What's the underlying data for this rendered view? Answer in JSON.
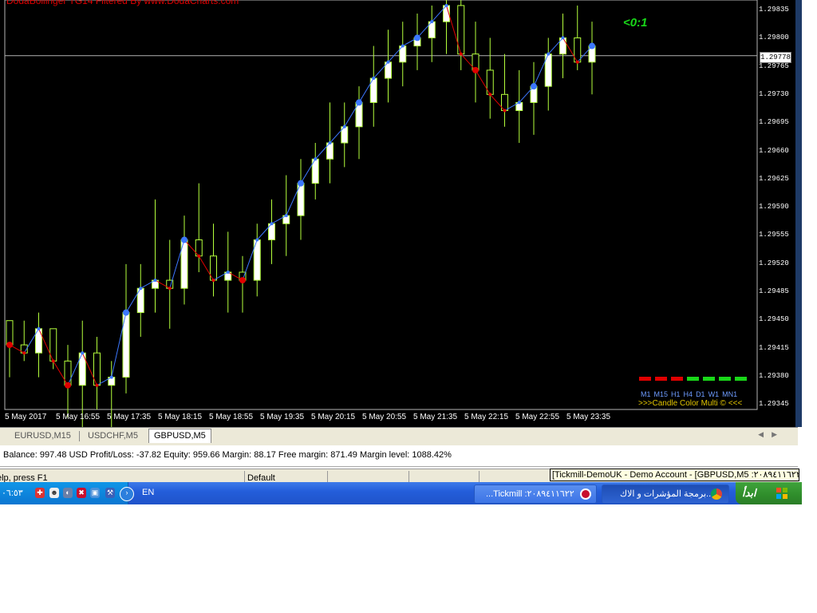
{
  "chart": {
    "title": "DodaBollinger TG14 Filtered By www.DodaCharts.com",
    "current_price": "1.29778",
    "ratio_label": "<0:1",
    "price_labels": [
      "1.29835",
      "1.29800",
      "1.29765",
      "1.29730",
      "1.29695",
      "1.29660",
      "1.29625",
      "1.29590",
      "1.29555",
      "1.29520",
      "1.29485",
      "1.29450",
      "1.29415",
      "1.29380",
      "1.29345"
    ],
    "time_labels": [
      "5 May 2017",
      "5 May 16:55",
      "5 May 17:35",
      "5 May 18:15",
      "5 May 18:55",
      "5 May 19:35",
      "5 May 20:15",
      "5 May 20:55",
      "5 May 21:35",
      "5 May 22:15",
      "5 May 22:55",
      "5 May 23:35"
    ],
    "timeframes": [
      "M1",
      "M15",
      "H1",
      "H4",
      "D1",
      "W1",
      "MN1"
    ],
    "indicator_name": ">>>Candle Color Multi  © <<<",
    "colors": {
      "up": "#b4ff3c",
      "bull_body": "#ffffff",
      "bear_body": "#000000",
      "red": "#e00000",
      "blue": "#3c78ff",
      "green": "#19d719",
      "grid": "#b4b4b4"
    },
    "timeframe_status": [
      "red",
      "red",
      "red",
      "green",
      "green",
      "green",
      "green"
    ]
  },
  "chart_data": {
    "type": "candlestick",
    "symbol": "GBPUSD,M5",
    "ylim": [
      1.29345,
      1.29835
    ],
    "series": [
      {
        "name": "candles",
        "values": [
          [
            1.2945,
            1.2945,
            1.2938,
            1.2942
          ],
          [
            1.2942,
            1.2945,
            1.294,
            1.2941
          ],
          [
            1.2941,
            1.2946,
            1.2938,
            1.2944
          ],
          [
            1.2944,
            1.2944,
            1.2939,
            1.294
          ],
          [
            1.294,
            1.2942,
            1.2933,
            1.2937
          ],
          [
            1.2937,
            1.2945,
            1.293,
            1.2941
          ],
          [
            1.2941,
            1.2943,
            1.2934,
            1.2937
          ],
          [
            1.2937,
            1.294,
            1.2931,
            1.2938
          ],
          [
            1.2938,
            1.2952,
            1.2936,
            1.2946
          ],
          [
            1.2946,
            1.2952,
            1.2943,
            1.2949
          ],
          [
            1.2949,
            1.296,
            1.2946,
            1.295
          ],
          [
            1.295,
            1.2955,
            1.2944,
            1.2949
          ],
          [
            1.2949,
            1.2958,
            1.2947,
            1.2955
          ],
          [
            1.2955,
            1.2962,
            1.2951,
            1.2953
          ],
          [
            1.2953,
            1.2957,
            1.2948,
            1.295
          ],
          [
            1.295,
            1.2956,
            1.2946,
            1.2951
          ],
          [
            1.2951,
            1.2953,
            1.2946,
            1.295
          ],
          [
            1.295,
            1.2957,
            1.2948,
            1.2955
          ],
          [
            1.2955,
            1.296,
            1.2952,
            1.2957
          ],
          [
            1.2957,
            1.2963,
            1.2953,
            1.2958
          ],
          [
            1.2958,
            1.2965,
            1.2955,
            1.2962
          ],
          [
            1.2962,
            1.2967,
            1.296,
            1.2965
          ],
          [
            1.2965,
            1.2972,
            1.2962,
            1.2967
          ],
          [
            1.2967,
            1.2972,
            1.2964,
            1.2969
          ],
          [
            1.2969,
            1.2974,
            1.2965,
            1.2972
          ],
          [
            1.2972,
            1.2979,
            1.2969,
            1.2975
          ],
          [
            1.2975,
            1.2981,
            1.2972,
            1.2977
          ],
          [
            1.2977,
            1.2982,
            1.2974,
            1.2979
          ],
          [
            1.2979,
            1.2983,
            1.2976,
            1.298
          ],
          [
            1.298,
            1.2984,
            1.2977,
            1.2982
          ],
          [
            1.2982,
            1.2985,
            1.2978,
            1.2984
          ],
          [
            1.2984,
            1.2986,
            1.2976,
            1.2978
          ],
          [
            1.2978,
            1.2982,
            1.2972,
            1.2976
          ],
          [
            1.2976,
            1.298,
            1.297,
            1.2973
          ],
          [
            1.2973,
            1.2978,
            1.2969,
            1.2971
          ],
          [
            1.2971,
            1.2976,
            1.2967,
            1.2972
          ],
          [
            1.2972,
            1.2977,
            1.2968,
            1.2974
          ],
          [
            1.2974,
            1.298,
            1.2971,
            1.2978
          ],
          [
            1.2978,
            1.2983,
            1.2975,
            1.298
          ],
          [
            1.298,
            1.2984,
            1.2976,
            1.2977
          ],
          [
            1.2977,
            1.2982,
            1.2973,
            1.2979
          ]
        ]
      }
    ]
  },
  "tabs": [
    {
      "label": "EURUSD,M15",
      "active": false
    },
    {
      "label": "USDCHF,M5",
      "active": false
    },
    {
      "label": "GBPUSD,M5",
      "active": true
    }
  ],
  "account": {
    "summary": "Balance: 997.48 USD  Profit/Loss: -37.82  Equity: 959.66  Margin: 88.17  Free margin: 871.49  Margin level: 1088.42%"
  },
  "status": {
    "help": "elp, press F1",
    "profile": "Default",
    "tooltip": "[Tickmill-DemoUK - Demo Account - [GBPUSD,M5 :٢٠٨٩٤١١٦٢٢"
  },
  "taskbar": {
    "clock": "٠٦:٥٣",
    "language": "EN",
    "task1": "...Tickmill :٢٠٨٩٤١١٦٢٢",
    "task2": "برمجة المؤشرات و الاك...",
    "start": "ابدأ"
  }
}
